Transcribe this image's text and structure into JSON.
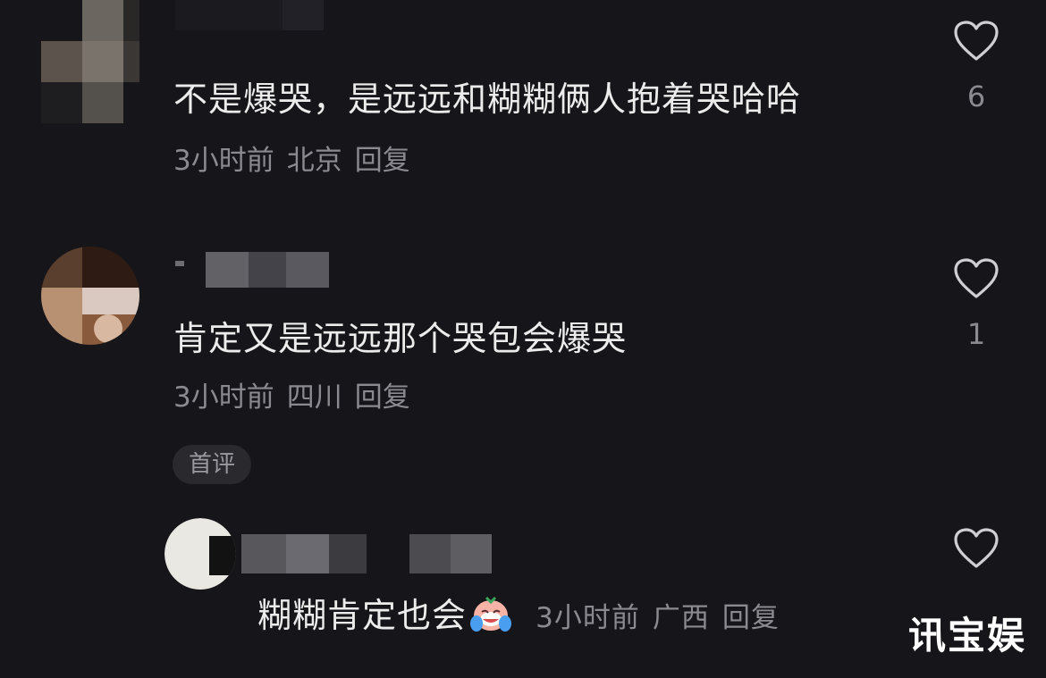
{
  "comments": [
    {
      "text": "不是爆哭，是远远和糊糊俩人抱着哭哈哈",
      "time": "3小时前",
      "location": "北京",
      "reply_label": "回复",
      "like_count": "6"
    },
    {
      "text": "肯定又是远远那个哭包会爆哭",
      "time": "3小时前",
      "location": "四川",
      "reply_label": "回复",
      "like_count": "1",
      "badge": "首评"
    }
  ],
  "reply": {
    "text": "糊糊肯定也会",
    "emoji": "crying-face-emoji",
    "time": "3小时前",
    "location": "广西",
    "reply_label": "回复"
  },
  "watermark": "讯宝娱",
  "colors": {
    "background": "#161519",
    "text": "#ececec",
    "meta": "#8b8a90",
    "badge_bg": "#2a2a2e"
  }
}
